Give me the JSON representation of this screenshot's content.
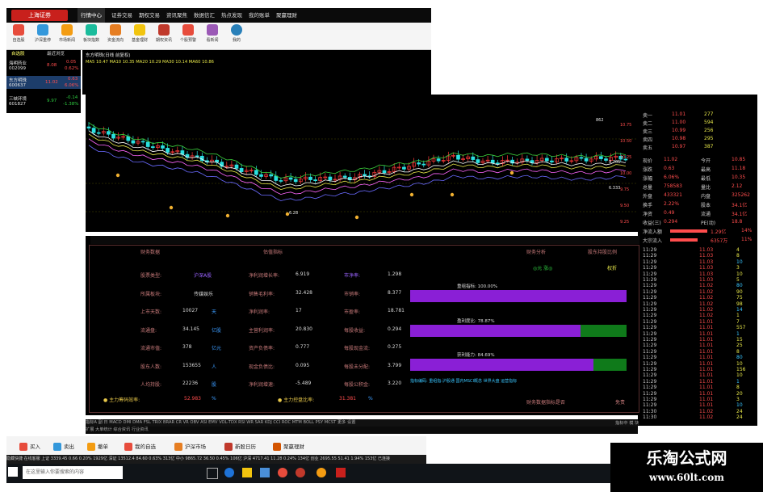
{
  "app": {
    "logo_text": "上海证券"
  },
  "menu": [
    "行情中心",
    "证券交易",
    "期权交易",
    "资讯聚焦",
    "数据信汇",
    "热点发现",
    "我的账单",
    "聚赢理财"
  ],
  "toolbar": [
    "自选股",
    "沪深重停",
    "市场新闻",
    "板块指数",
    "资金流向",
    "基金理财",
    "期权资讯",
    "个股预警",
    "看新闻",
    "我的"
  ],
  "watch": {
    "tabs": [
      "自选股",
      "最近浏览"
    ],
    "rows": [
      {
        "name": "海明药业",
        "code": "002099",
        "price": "8.08",
        "chg": "0.05",
        "pct": "0.62%"
      },
      {
        "name": "东方明珠",
        "code": "600637",
        "price": "11.02",
        "chg": "0.63",
        "pct": "6.06%"
      },
      {
        "name": "三峡环境",
        "code": "601827",
        "price": "9.97",
        "chg": "-0.14",
        "pct": "-1.38%"
      }
    ]
  },
  "chart_header": {
    "line1": "东方明珠(日线 前复权)",
    "line2": "MA5 10.47  MA10 10.35  MA20 10.29  MA30 10.14  MA60 10.86"
  },
  "price_axis": [
    "10.75",
    "10.50",
    "10.25",
    "10.00",
    "9.75",
    "9.50",
    "9.25"
  ],
  "chart_labels": {
    "high": "862",
    "low": "6.28",
    "mid1": "8.705",
    "mid2": "6.333"
  },
  "quote": {
    "sells": [
      {
        "l": "卖一",
        "p": "11.01",
        "v": "277"
      },
      {
        "l": "卖二",
        "p": "11.00",
        "v": "594"
      },
      {
        "l": "卖三",
        "p": "10.99",
        "v": "256"
      },
      {
        "l": "卖四",
        "p": "10.98",
        "v": "295"
      },
      {
        "l": "卖五",
        "p": "10.97",
        "v": "387"
      }
    ],
    "stats": [
      {
        "l": "现价",
        "v": "11.02",
        "l2": "今开",
        "v2": "10.85"
      },
      {
        "l": "涨跌",
        "v": "0.63",
        "l2": "最高",
        "v2": "11.18"
      },
      {
        "l": "涨幅",
        "v": "6.06%",
        "l2": "最低",
        "v2": "10.35"
      },
      {
        "l": "总量",
        "v": "758583",
        "l2": "量比",
        "v2": "2.12"
      },
      {
        "l": "外盘",
        "v": "433321",
        "l2": "内盘",
        "v2": "325262"
      },
      {
        "l": "换手",
        "v": "2.22%",
        "l2": "股本",
        "v2": "34.1亿"
      },
      {
        "l": "净资",
        "v": "0.49",
        "l2": "流通",
        "v2": "34.1亿"
      },
      {
        "l": "收益(三)",
        "v": "0.294",
        "l2": "PE(动)",
        "v2": "18.8"
      }
    ],
    "flow": [
      {
        "l": "净流入额",
        "v": "1.29亿",
        "p": "14%"
      },
      {
        "l": "大宗流入",
        "v": "6357万",
        "p": "11%"
      }
    ],
    "ticks": [
      {
        "t": "11:29",
        "p": "11.03",
        "v": "4"
      },
      {
        "t": "11:29",
        "p": "11.03",
        "v": "8"
      },
      {
        "t": "11:29",
        "p": "11.03",
        "v": "10"
      },
      {
        "t": "11:29",
        "p": "11.03",
        "v": "3"
      },
      {
        "t": "11:29",
        "p": "11.03",
        "v": "10"
      },
      {
        "t": "11:29",
        "p": "11.03",
        "v": "5"
      },
      {
        "t": "11:29",
        "p": "11.02",
        "v": "80"
      },
      {
        "t": "11:29",
        "p": "11.02",
        "v": "90"
      },
      {
        "t": "11:29",
        "p": "11.02",
        "v": "75"
      },
      {
        "t": "11:29",
        "p": "11.02",
        "v": "98"
      },
      {
        "t": "11:29",
        "p": "11.02",
        "v": "14"
      },
      {
        "t": "11:29",
        "p": "11.02",
        "v": "1"
      },
      {
        "t": "11:29",
        "p": "11.01",
        "v": "7"
      },
      {
        "t": "11:29",
        "p": "11.01",
        "v": "557"
      },
      {
        "t": "11:29",
        "p": "11.01",
        "v": "1"
      },
      {
        "t": "11:29",
        "p": "11.01",
        "v": "15"
      },
      {
        "t": "11:29",
        "p": "11.01",
        "v": "25"
      },
      {
        "t": "11:29",
        "p": "11.01",
        "v": "8"
      },
      {
        "t": "11:29",
        "p": "11.01",
        "v": "80"
      },
      {
        "t": "11:29",
        "p": "11.01",
        "v": "10"
      },
      {
        "t": "11:29",
        "p": "11.01",
        "v": "156"
      },
      {
        "t": "11:29",
        "p": "11.01",
        "v": "10"
      },
      {
        "t": "11:29",
        "p": "11.01",
        "v": "1"
      },
      {
        "t": "11:29",
        "p": "11.01",
        "v": "8"
      },
      {
        "t": "11:29",
        "p": "11.01",
        "v": "20"
      },
      {
        "t": "11:29",
        "p": "11.01",
        "v": "3"
      },
      {
        "t": "11:29",
        "p": "11.01",
        "v": "10"
      },
      {
        "t": "11:30",
        "p": "11.02",
        "v": "24"
      },
      {
        "t": "11:30",
        "p": "11.02",
        "v": "24"
      }
    ]
  },
  "fin": {
    "header_left": "财务数据",
    "header_mid": "估值指标",
    "header_right": "财务分析",
    "header_right2": "股东持股比例",
    "rows": [
      {
        "l1": "股票类型:",
        "v1": "沪深A股",
        "l2": "净利润增长率:",
        "v2": "6.919",
        "l3": "市净率:",
        "v3": "1.298"
      },
      {
        "l1": "所属板块:",
        "v1": "传媒娱乐",
        "l2": "销售毛利率:",
        "v2": "32.428",
        "l3": "市销率:",
        "v3": "8.377"
      },
      {
        "l1": "上市天数:",
        "v1": "10027",
        "u1": "天",
        "l2": "净利润率:",
        "v2": "17",
        "l3": "市盈率:",
        "v3": "18.781"
      },
      {
        "l1": "流通盘:",
        "v1": "34.145",
        "u1": "亿股",
        "l2": "主营利润率:",
        "v2": "20.830",
        "l3": "每股收益:",
        "v3": "0.294"
      },
      {
        "l1": "流通市值:",
        "v1": "378",
        "u1": "亿元",
        "l2": "资产负债率:",
        "v2": "0.777",
        "l3": "每股现金流:",
        "v3": "0.275"
      },
      {
        "l1": "股东人数:",
        "v1": "153655",
        "u1": "人",
        "l2": "现金负债比:",
        "v2": "0.095",
        "l3": "每股未分配:",
        "v3": "3.799"
      },
      {
        "l1": "人均持股:",
        "v1": "22236",
        "u1": "股",
        "l2": "净利润增速:",
        "v2": "-5.489",
        "l3": "每股公积金:",
        "v3": "3.220"
      }
    ],
    "bottom": [
      {
        "l": "主力筹码效率:",
        "v": "52.983",
        "u": "%"
      },
      {
        "l": "主力控盘比率:",
        "v": "31.381",
        "u": "%"
      }
    ],
    "right_tabs": [
      "◎元 涨◎",
      "权折"
    ],
    "bars": [
      {
        "label": "重组指标: 100.00%",
        "pct": 100
      },
      {
        "label": "盈利度比: 78.87%",
        "pct": 78.87
      },
      {
        "label": "获利能力: 84.69%",
        "pct": 84.69
      }
    ],
    "note": "指标编码: 重组指:沪股通 国内MSCI概念 世界大盘 运营指标",
    "right_bottom": "财务数据指标是否",
    "right_bottom2": "免责"
  },
  "indicators": "指标A  副 日  MACD  DMI  DMA  FSL  TRIX  BRAR  CR  VR  OBV  ASI  EMV  VOL-TDX  RSI  WR  SAR  KDJ  CCI  ROC  MTM  BOLL  PSY  MCST  更多  设置",
  "indicators2": "扩展  大单统计  综合资讯  行业资讯",
  "ind_right": "指标中  模  块",
  "bottom_bar": [
    "买入",
    "卖出",
    "撤单",
    "我的自选",
    "沪深市场",
    "新股日历",
    "聚赢理财"
  ],
  "taskbar": {
    "text": "隐藏快捷  在线客服  上证 3339.45  0.66  0.20%  1929亿  深证 13512.4  84.60  0.63%  313亿  中小 9865.72  36.50  0.45%  106亿  沪深 4717.41  11.28  0.24%  134亿  创业 2695.55  51.41  1.94%  153亿  已连接",
    "search": "在这里输入你要搜索的内容"
  },
  "watermark": {
    "cn": "乐淘公式网",
    "url": "www.60lt.com"
  },
  "colors": {
    "up": "#ff4d4d",
    "down": "#2ecc40",
    "bar_purple": "#8a1fd6",
    "bar_green": "#0f7a1a"
  }
}
